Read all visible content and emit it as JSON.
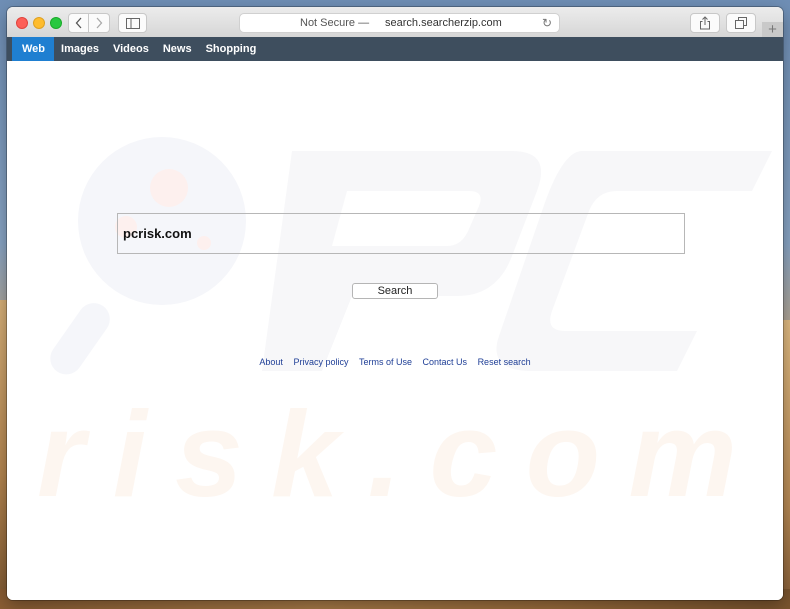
{
  "browser": {
    "address_bar": {
      "security_label": "Not Secure —",
      "url": "search.searcherzip.com"
    },
    "new_tab_label": "+"
  },
  "icons": {
    "back": "‹",
    "forward": "›",
    "reload": "↻"
  },
  "nav": {
    "items": [
      {
        "label": "Web",
        "active": true
      },
      {
        "label": "Images",
        "active": false
      },
      {
        "label": "Videos",
        "active": false
      },
      {
        "label": "News",
        "active": false
      },
      {
        "label": "Shopping",
        "active": false
      }
    ]
  },
  "search": {
    "value": "pcrisk.com",
    "button_label": "Search"
  },
  "footer": {
    "links": [
      "About",
      "Privacy policy",
      "Terms of Use",
      "Contact Us",
      "Reset search"
    ]
  },
  "watermark": {
    "text_top": "PC",
    "text_bottom": "risk.com"
  },
  "colors": {
    "nav_bg": "#3e4e5e",
    "nav_active": "#1f7fd1",
    "link": "#1e3e96"
  }
}
